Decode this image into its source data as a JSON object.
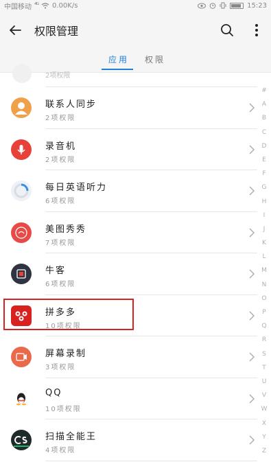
{
  "status_bar": {
    "carrier": "中国移动",
    "signal": "⁴ᴳ",
    "speed": "0.00K/s",
    "time": "15:23",
    "battery_level": 0.85
  },
  "header": {
    "title": "权限管理"
  },
  "tabs": [
    {
      "label": "应用",
      "active": true
    },
    {
      "label": "权限",
      "active": false
    }
  ],
  "list": {
    "partial_item_sub": "2项权限",
    "items": [
      {
        "name": "联系人同步",
        "sub": "2项权限",
        "icon": "contacts-sync-icon",
        "color": "#f0a04b"
      },
      {
        "name": "录音机",
        "sub": "2项权限",
        "icon": "recorder-icon",
        "color": "#e8413a"
      },
      {
        "name": "每日英语听力",
        "sub": "6项权限",
        "icon": "english-listening-icon",
        "color": "#3a8ee6"
      },
      {
        "name": "美图秀秀",
        "sub": "7项权限",
        "icon": "meitu-icon",
        "color": "#e84a48"
      },
      {
        "name": "牛客",
        "sub": "6项权限",
        "icon": "nowcoder-icon",
        "color": "#2f3440"
      },
      {
        "name": "拼多多",
        "sub": "10项权限",
        "icon": "pinduoduo-icon",
        "color": "#d8221f"
      },
      {
        "name": "屏幕录制",
        "sub": "3项权限",
        "icon": "screen-record-icon",
        "color": "#e86a4b"
      },
      {
        "name": "QQ",
        "sub": "10项权限",
        "icon": "qq-icon",
        "color": "#222222"
      },
      {
        "name": "扫描全能王",
        "sub": "4项权限",
        "icon": "camscanner-icon",
        "color": "#1f2a2a"
      }
    ]
  },
  "alpha_index": [
    "#",
    "A",
    "B",
    "C",
    "D",
    "E",
    "F",
    "G",
    "H",
    "I",
    "J",
    "K",
    "L",
    "M",
    "N",
    "O",
    "P",
    "Q",
    "R",
    "S",
    "T",
    "U",
    "V",
    "W",
    "X",
    "Y",
    "Z"
  ],
  "accent_color": "#1e7fd8",
  "highlight_color": "#d8221f"
}
